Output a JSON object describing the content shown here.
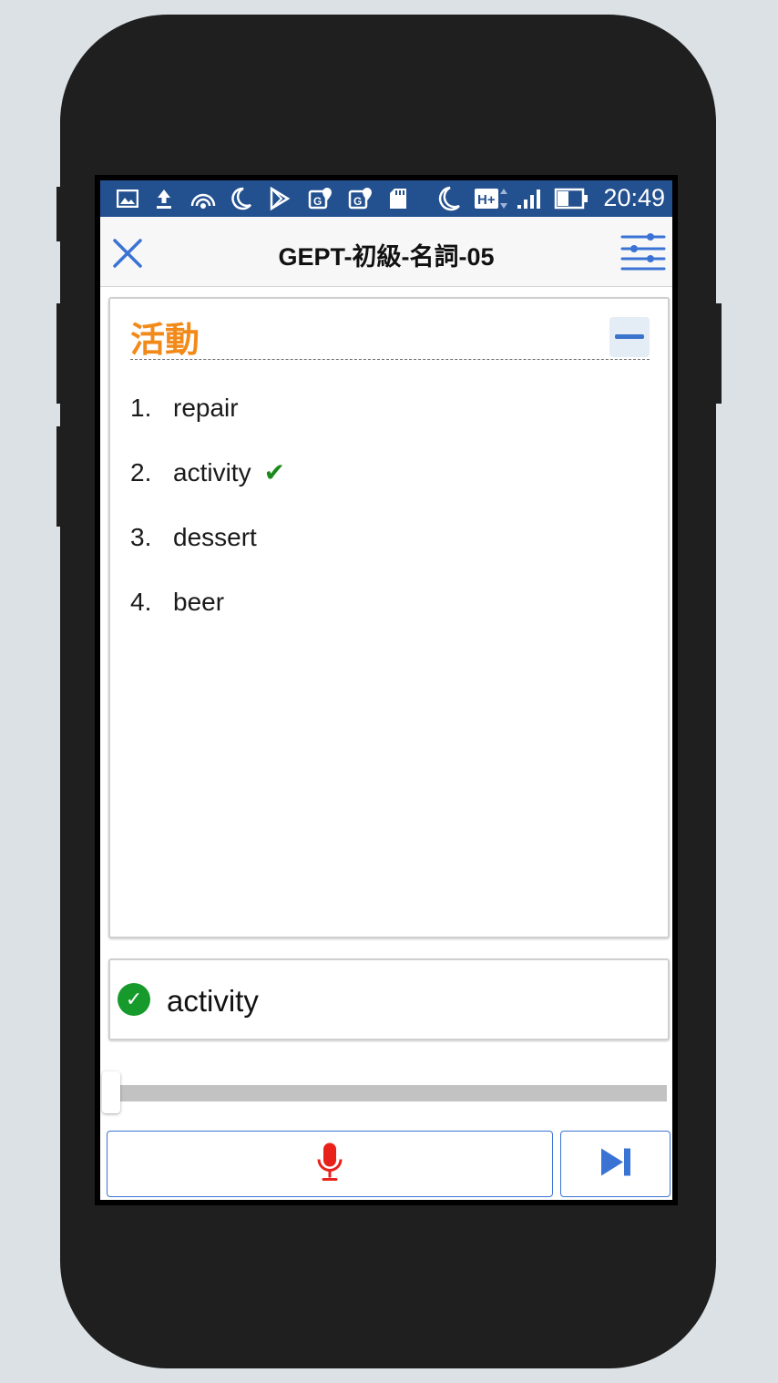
{
  "status_bar": {
    "time": "20:49",
    "network": "H+",
    "icons": [
      "image-icon",
      "upload-icon",
      "hotspot-icon",
      "moon-icon",
      "play-store-icon",
      "maps-icon",
      "maps-icon",
      "sd-card-icon",
      "moon-icon",
      "network-h-plus-icon",
      "signal-icon",
      "battery-icon"
    ]
  },
  "header": {
    "title": "GEPT-初級-名詞-05",
    "close_icon": "close-icon",
    "settings_icon": "sliders-icon"
  },
  "question": {
    "word": "活動",
    "options": [
      {
        "number": "1.",
        "text": "repair",
        "correct": false
      },
      {
        "number": "2.",
        "text": "activity",
        "correct": true
      },
      {
        "number": "3.",
        "text": "dessert",
        "correct": false
      },
      {
        "number": "4.",
        "text": "beer",
        "correct": false
      }
    ],
    "check_mark": "✔"
  },
  "answer": {
    "text": "activity",
    "icon": "check-circle-icon",
    "icon_glyph": "✓"
  },
  "progress": {
    "value": 0
  },
  "controls": {
    "mic_icon": "microphone-icon",
    "next_icon": "skip-next-icon"
  },
  "colors": {
    "status_bar": "#23508f",
    "accent": "#3b73d4",
    "word": "#f28a1a",
    "correct": "#179a2c",
    "mic": "#e8211a"
  }
}
